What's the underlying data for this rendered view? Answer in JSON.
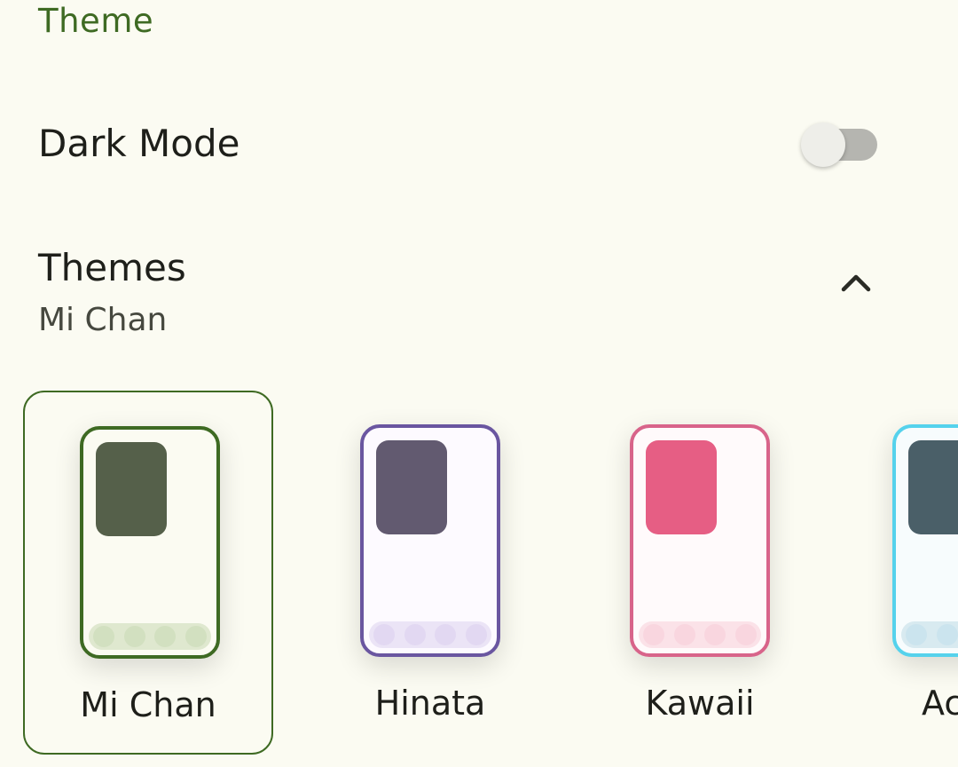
{
  "section": {
    "title": "Theme"
  },
  "dark_mode": {
    "label": "Dark Mode",
    "enabled": false
  },
  "themes": {
    "label": "Themes",
    "current": "Mi Chan",
    "expanded": true,
    "options": [
      {
        "name": "Mi Chan",
        "selected": true,
        "border": "#3e6a23",
        "screen": "#fbfbf2",
        "block": "#55604a",
        "nav": "#dfe8cf",
        "dot": "#d2e0c0"
      },
      {
        "name": "Hinata",
        "selected": false,
        "border": "#6a56a0",
        "screen": "#fdfaff",
        "block": "#625a70",
        "nav": "#ebe4f6",
        "dot": "#e2d8f2"
      },
      {
        "name": "Kawaii",
        "selected": false,
        "border": "#d8648a",
        "screen": "#fffafb",
        "block": "#e65e84",
        "nav": "#fbe2e8",
        "dot": "#f9d6df"
      },
      {
        "name": "Ac",
        "selected": false,
        "border": "#55d2ec",
        "screen": "#f7fcfd",
        "block": "#4a5f68",
        "nav": "#d8eaf0",
        "dot": "#cbe4ee"
      }
    ]
  },
  "icons": {
    "chevron": "chevron-up-icon"
  }
}
